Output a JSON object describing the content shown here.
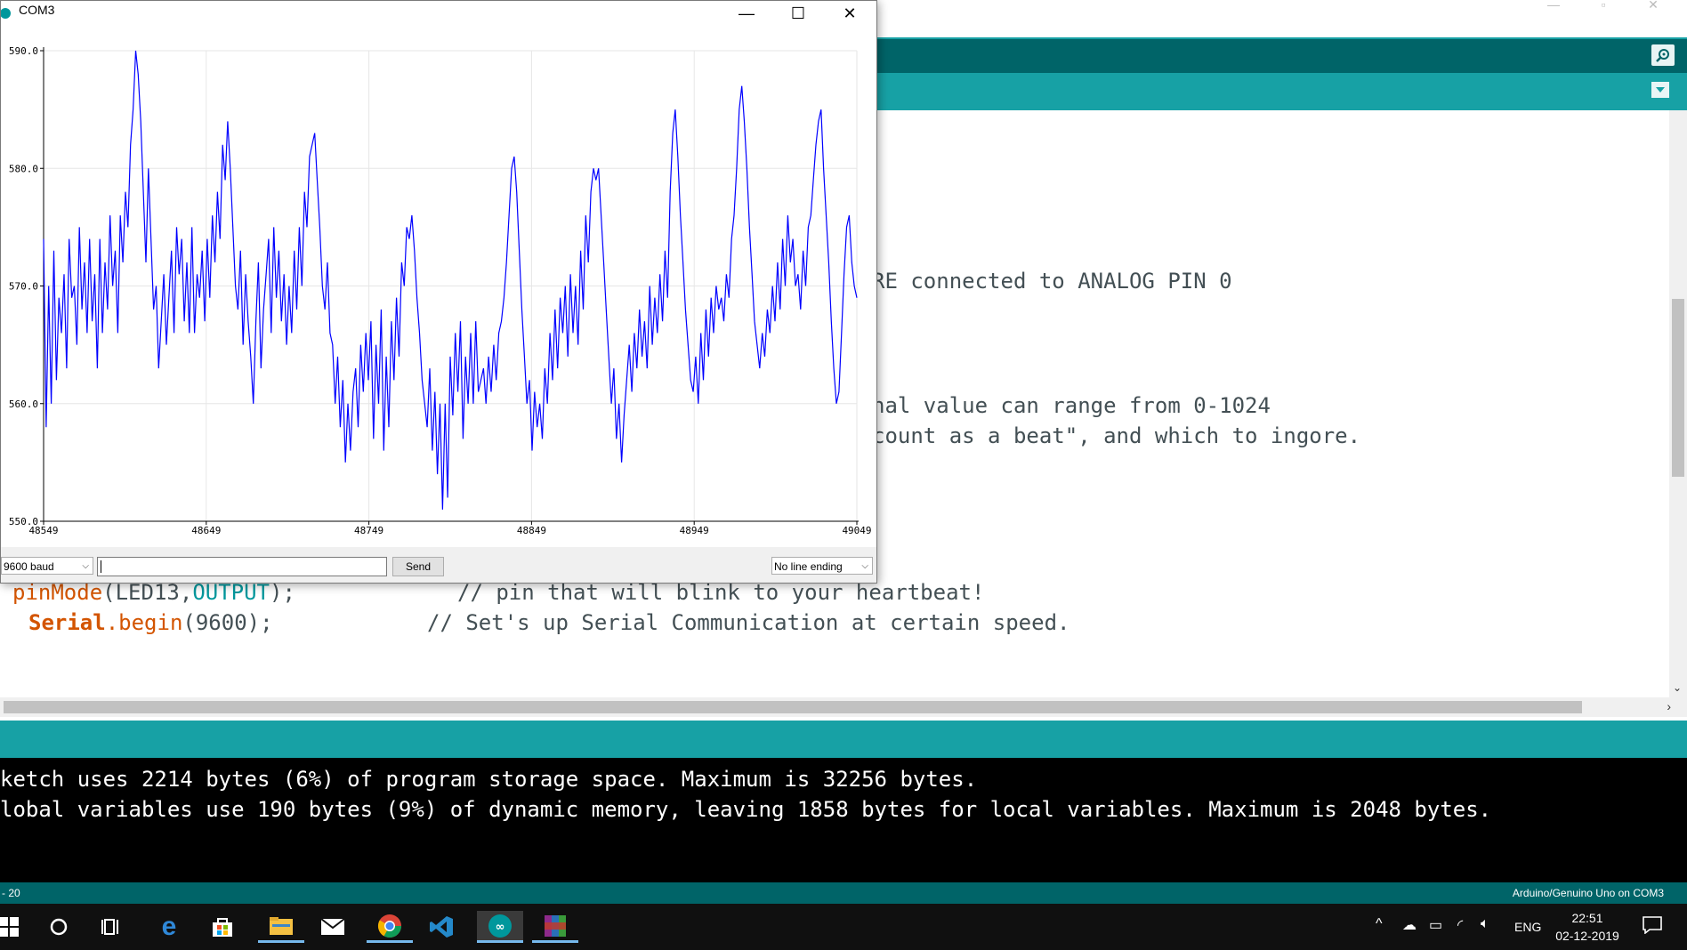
{
  "ide": {
    "editor_lines": [
      {
        "text": "RE connected to ANALOG PIN 0"
      },
      {
        "text": "nal value can range from 0-1024"
      },
      {
        "text": "count as a beat\", and which to ingore."
      }
    ],
    "pinmode_line": {
      "fn": "pinMode",
      "open": "(LED13,",
      "arg": "OUTPUT",
      "close": ");",
      "comment": "// pin that will blink to your heartbeat!"
    },
    "serial_line": {
      "obj": "Serial",
      "method": ".begin",
      "args": "(9600);",
      "comment": "// Set's up Serial Communication at certain speed."
    },
    "console_lines": [
      "ketch uses 2214 bytes (6%) of program storage space. Maximum is 32256 bytes.",
      "lobal variables use 190 bytes (9%) of dynamic memory, leaving 1858 bytes for local variables. Maximum is 2048 bytes."
    ],
    "status_left": "- 20",
    "status_right": "Arduino/Genuino Uno on COM3",
    "colors": {
      "teal_dark": "#006468",
      "teal": "#17a1a5",
      "keyword_orange": "#d35400",
      "keyword_teal": "#00979c"
    }
  },
  "plotter": {
    "title": "COM3",
    "baud": "9600 baud",
    "send_value": "",
    "send_label": "Send",
    "line_ending": "No line ending",
    "line_color": "#0000ff"
  },
  "chart_data": {
    "type": "line",
    "title": "",
    "xlabel": "",
    "ylabel": "",
    "xlim": [
      48549,
      49049
    ],
    "ylim": [
      550,
      590
    ],
    "x_ticks": [
      "48549",
      "48649",
      "48749",
      "48849",
      "48949",
      "49049"
    ],
    "y_ticks": [
      "550.0",
      "560.0",
      "570.0",
      "580.0",
      "590.0"
    ],
    "grid": true,
    "series": [
      {
        "values": [
          574,
          558,
          570,
          560,
          573,
          562,
          569,
          566,
          571,
          563,
          574,
          569,
          570,
          565,
          575,
          568,
          572,
          566,
          574,
          567,
          571,
          563,
          574,
          566,
          572,
          568,
          576,
          570,
          573,
          566,
          576,
          572,
          578,
          575,
          582,
          585,
          590,
          588,
          584,
          578,
          572,
          580,
          574,
          568,
          570,
          563,
          567,
          571,
          565,
          569,
          573,
          566,
          575,
          571,
          574,
          567,
          572,
          566,
          575,
          566,
          571,
          569,
          573,
          567,
          574,
          569,
          576,
          572,
          578,
          574,
          582,
          579,
          584,
          580,
          575,
          570,
          568,
          573,
          565,
          571,
          567,
          564,
          560,
          567,
          572,
          563,
          568,
          571,
          574,
          566,
          575,
          569,
          573,
          567,
          571,
          565,
          570,
          566,
          573,
          568,
          575,
          570,
          578,
          575,
          581,
          582,
          583,
          579,
          575,
          570,
          568,
          572,
          566,
          565,
          560,
          564,
          558,
          562,
          555,
          560,
          556,
          561,
          563,
          558,
          565,
          561,
          566,
          562,
          567,
          557,
          565,
          560,
          568,
          556,
          564,
          558,
          567,
          562,
          569,
          564,
          572,
          570,
          575,
          574,
          576,
          573,
          569,
          566,
          562,
          560,
          558,
          563,
          556,
          561,
          554,
          560,
          551,
          560,
          552,
          564,
          559,
          566,
          561,
          567,
          557,
          564,
          560,
          566,
          560,
          567,
          561,
          562,
          563,
          560,
          564,
          561,
          565,
          562,
          566,
          567,
          569,
          572,
          576,
          580,
          581,
          578,
          573,
          568,
          564,
          560,
          562,
          556,
          561,
          558,
          560,
          557,
          563,
          560,
          566,
          562,
          568,
          563,
          569,
          566,
          570,
          564,
          571,
          566,
          570,
          565,
          573,
          568,
          576,
          572,
          578,
          580,
          579,
          580,
          576,
          572,
          568,
          564,
          560,
          563,
          557,
          560,
          555,
          559,
          562,
          565,
          561,
          566,
          563,
          568,
          564,
          567,
          563,
          570,
          565,
          569,
          566,
          571,
          567,
          573,
          569,
          578,
          583,
          585,
          581,
          576,
          572,
          568,
          565,
          562,
          561,
          564,
          560,
          566,
          562,
          568,
          564,
          569,
          566,
          570,
          568,
          569,
          567,
          571,
          569,
          574,
          576,
          580,
          585,
          587,
          584,
          580,
          575,
          571,
          567,
          565,
          563,
          566,
          564,
          568,
          566,
          570,
          567,
          572,
          568,
          574,
          570,
          576,
          572,
          574,
          570,
          571,
          568,
          573,
          570,
          575,
          576,
          579,
          582,
          584,
          585,
          580,
          576,
          572,
          567,
          563,
          560,
          561,
          566,
          571,
          575,
          576,
          572,
          570,
          569
        ]
      }
    ]
  }
}
